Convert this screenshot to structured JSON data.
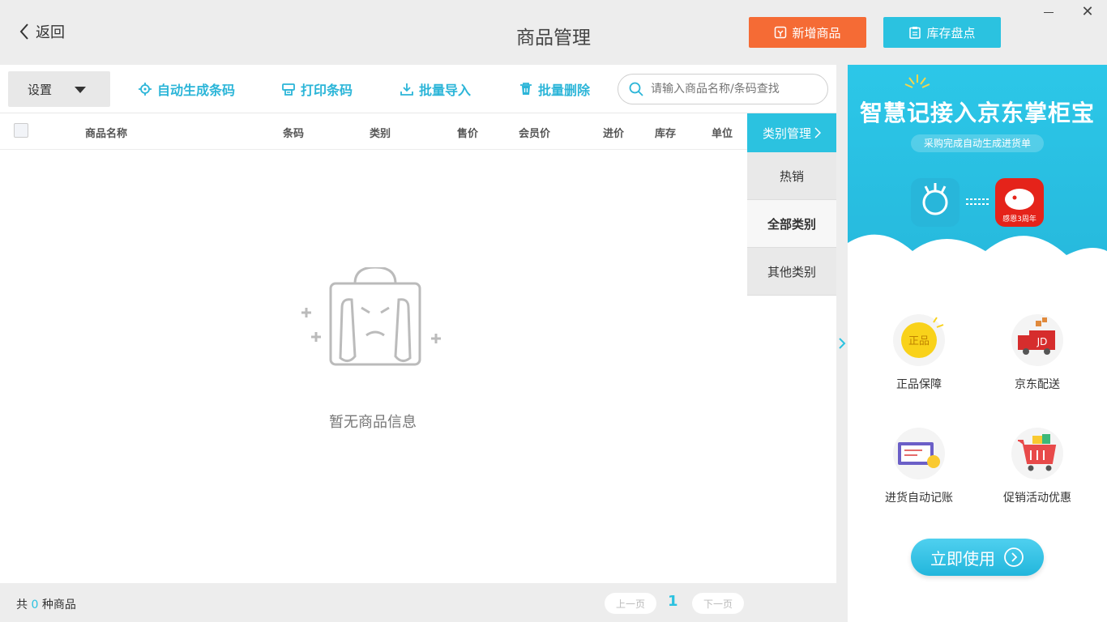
{
  "header": {
    "back_label": "返回",
    "title": "商品管理",
    "add_button": "新增商品",
    "stock_button": "库存盘点",
    "close_glyph": "✕"
  },
  "toolbar": {
    "settings_label": "设置",
    "auto_barcode": "自动生成条码",
    "print_barcode": "打印条码",
    "batch_import": "批量导入",
    "batch_delete": "批量删除",
    "search_placeholder": "请输入商品名称/条码查找"
  },
  "table": {
    "columns": [
      "商品名称",
      "条码",
      "类别",
      "售价",
      "会员价",
      "进价",
      "库存",
      "单位"
    ],
    "empty_text": "暂无商品信息"
  },
  "categories": {
    "header": "类别管理",
    "items": [
      "热销",
      "全部类别",
      "其他类别"
    ],
    "active_index": 1
  },
  "footer": {
    "count_prefix": "共",
    "count": "0",
    "count_suffix": "种商品",
    "prev": "上一页",
    "page": "1",
    "next": "下一页"
  },
  "ad": {
    "title": "智慧记接入京东掌柜宝",
    "subtitle": "采购完成自动生成进货单",
    "jd_badge_text": "感恩3周年",
    "features": [
      {
        "label": "正品保障",
        "icon": "genuine-icon",
        "icon_text": "正品"
      },
      {
        "label": "京东配送",
        "icon": "jd-truck-icon",
        "icon_text": "JD"
      },
      {
        "label": "进货自动记账",
        "icon": "bookkeeping-icon"
      },
      {
        "label": "促销活动优惠",
        "icon": "cart-icon"
      }
    ],
    "cta": "立即使用"
  },
  "colors": {
    "accent": "#2bc2e0",
    "orange": "#f56b35",
    "background": "#ededed"
  }
}
